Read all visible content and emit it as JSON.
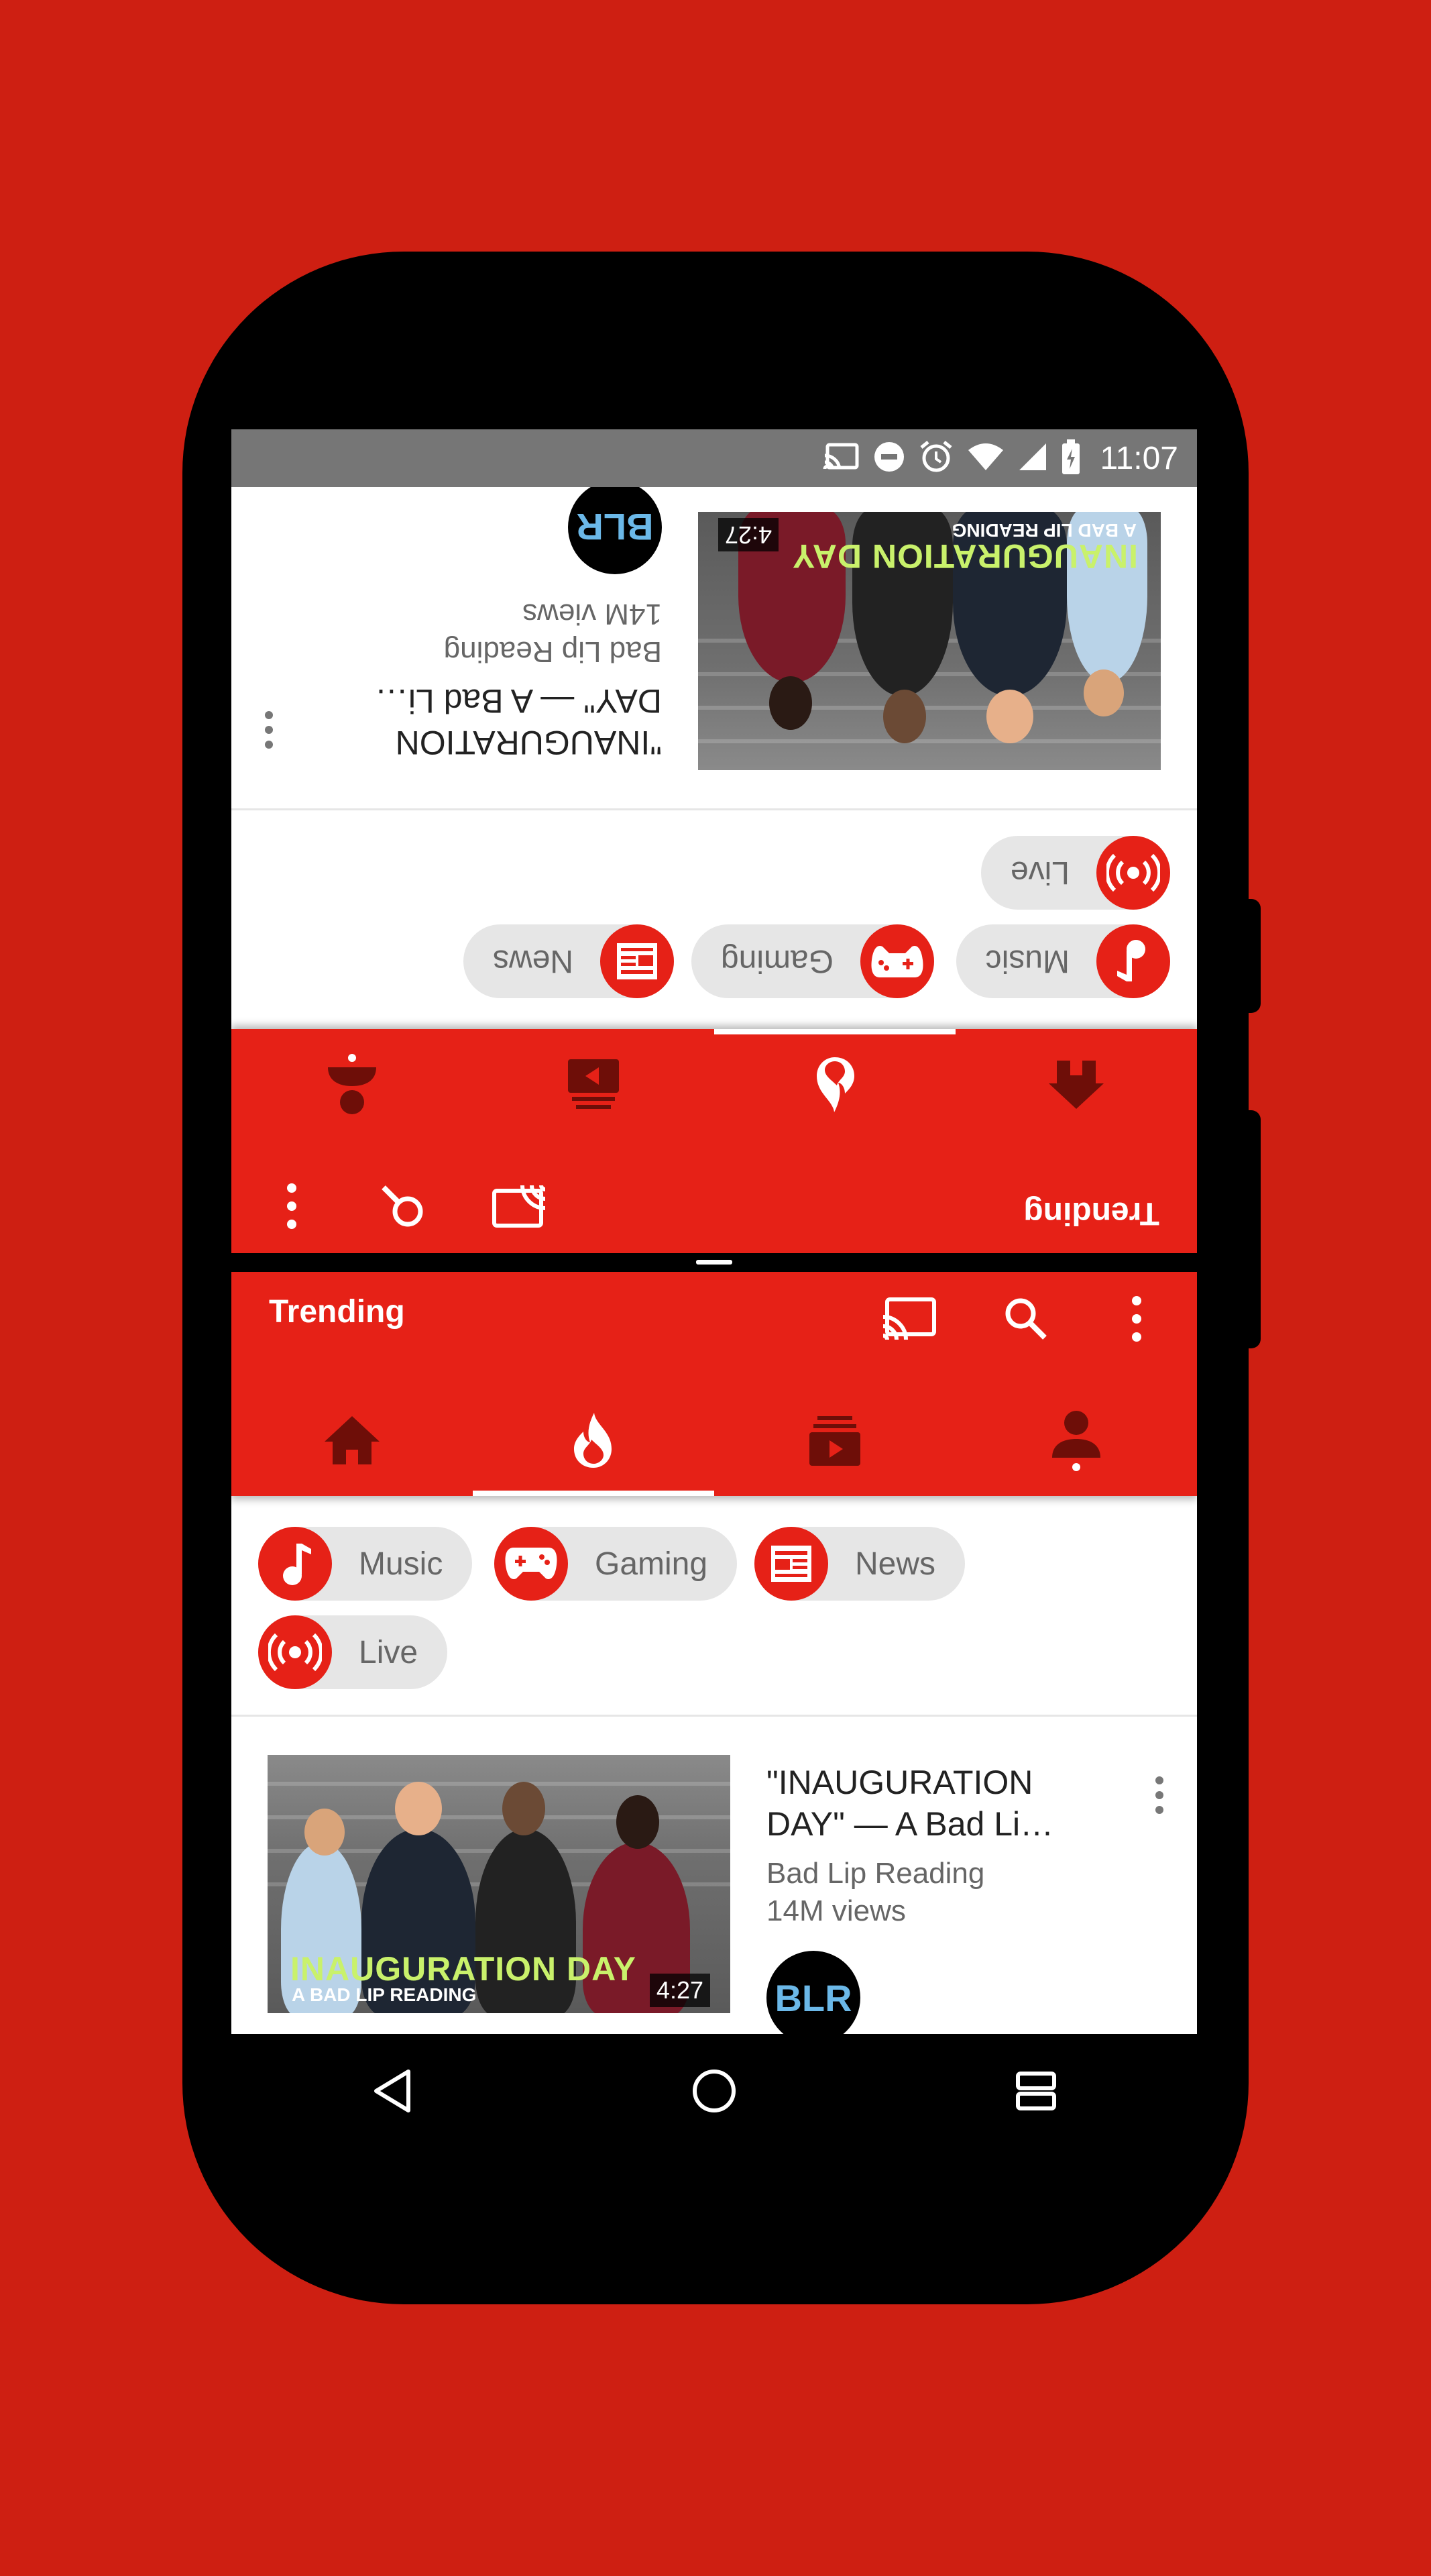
{
  "colors": {
    "background": "#CE1F12",
    "app_red": "#E62117",
    "status_bar": "#767676"
  },
  "status_bar": {
    "time": "11:07",
    "icons": [
      "cast-icon",
      "do-not-disturb-icon",
      "alarm-icon",
      "wifi-icon",
      "signal-icon",
      "battery-icon"
    ]
  },
  "app": {
    "title": "Trending",
    "actions": [
      "cast-icon",
      "search-icon",
      "more-vert-icon"
    ],
    "tabs": [
      {
        "icon": "home-icon",
        "selected": false
      },
      {
        "icon": "trending-flame-icon",
        "selected": true
      },
      {
        "icon": "subscriptions-icon",
        "selected": false
      },
      {
        "icon": "account-icon",
        "selected": false
      }
    ],
    "chips": [
      {
        "label": "Music",
        "icon": "music-note-icon"
      },
      {
        "label": "Gaming",
        "icon": "gamepad-icon"
      },
      {
        "label": "News",
        "icon": "news-icon"
      },
      {
        "label": "Live",
        "icon": "live-broadcast-icon"
      }
    ],
    "video": {
      "title": "\"INAUGURATION DAY\" — A Bad Li…",
      "channel": "Bad Lip Reading",
      "views": "14M views",
      "duration": "4:27",
      "thumb_caption_1": "INAUGURATION DAY",
      "thumb_caption_2": "A BAD LIP READING",
      "avatar_text": "BLR"
    }
  },
  "nav_bar": [
    "back-icon",
    "home-circle-icon",
    "recents-icon"
  ]
}
